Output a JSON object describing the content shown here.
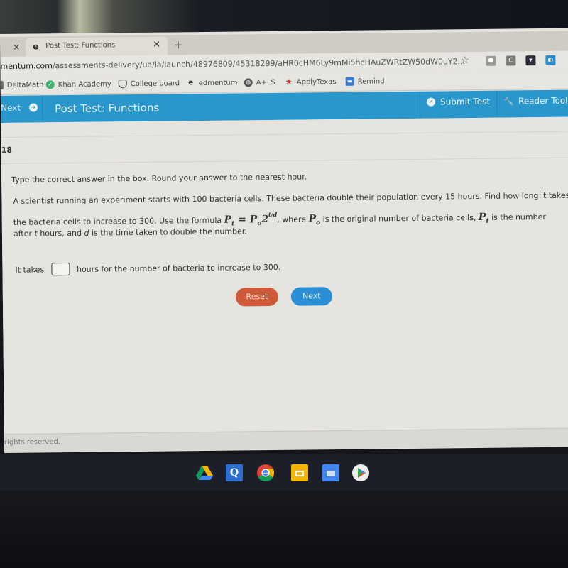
{
  "browser": {
    "tab_title": "Post Test: Functions",
    "tab_favicon": "e",
    "new_tab_label": "+",
    "url_host": "mentum.com",
    "url_path": "/assessments-delivery/ua/la/launch/48976809/45318299/aHR0cHM6Ly9mMi5hcHAuZWRtZW50dW0uY2...",
    "bookmark_star": "☆",
    "extensions": [
      "puzzle-extension-icon",
      "c-extension-icon",
      "download-extension-icon",
      "blue-extension-icon"
    ]
  },
  "bookmarks": [
    {
      "label": "DeltaMath",
      "icon": "deltamath-icon"
    },
    {
      "label": "Khan Academy",
      "icon": "khan-academy-icon"
    },
    {
      "label": "College board",
      "icon": "college-board-icon"
    },
    {
      "label": "edmentum",
      "icon": "edmentum-icon"
    },
    {
      "label": "A+LS",
      "icon": "globe-icon"
    },
    {
      "label": "ApplyTexas",
      "icon": "star-icon"
    },
    {
      "label": "Remind",
      "icon": "remind-icon"
    }
  ],
  "topnav": {
    "next_label": "Next",
    "title": "Post Test: Functions",
    "submit_label": "Submit Test",
    "reader_label": "Reader Tool"
  },
  "question": {
    "number": "18",
    "instruction": "Type the correct answer in the box. Round your answer to the nearest hour.",
    "line1": "A scientist running an experiment starts with 100 bacteria cells. These bacteria double their population every 15 hours. Find how long it takes for",
    "line2_pre": "the bacteria cells to increase to 300. Use the formula",
    "formula": "P_t = P_o 2^(t/d)",
    "line2_mid": ", where",
    "line2_po_desc": "is the original number of bacteria cells,",
    "line2_pt_desc": "is the number",
    "line3_pre": "after",
    "line3_t": "t",
    "line3_mid": "hours, and",
    "line3_d": "d",
    "line3_post": "is the time taken to double the number.",
    "answer_prefix": "It takes",
    "answer_value": "",
    "answer_suffix": "hours for the number of bacteria to increase to 300."
  },
  "buttons": {
    "reset": "Reset",
    "next": "Next"
  },
  "footer": {
    "text": "rights reserved."
  },
  "shelf": {
    "apps": [
      "google-drive-icon",
      "quizlet-icon",
      "chrome-icon",
      "google-slides-icon",
      "google-docs-icon",
      "play-store-icon"
    ]
  },
  "colors": {
    "nav_blue": "#2a97cc",
    "reset_orange": "#cf5a3a",
    "next_blue": "#2b8fd6"
  }
}
